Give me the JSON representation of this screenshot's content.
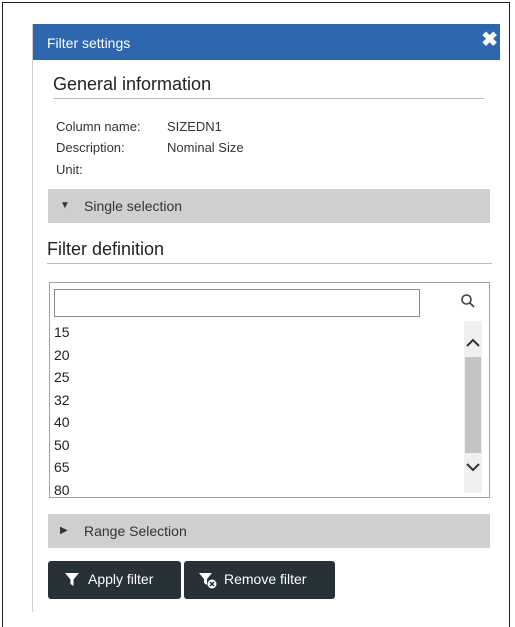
{
  "header": {
    "title": "Filter settings",
    "close_icon": "close-icon"
  },
  "general": {
    "title": "General information",
    "column_name_label": "Column name:",
    "column_name_value": "SIZEDN1",
    "description_label": "Description:",
    "description_value": "Nominal Size",
    "unit_label": "Unit:",
    "unit_value": ""
  },
  "single_selection": {
    "label": "Single selection",
    "state": "expanded"
  },
  "filter_definition": {
    "title": "Filter definition",
    "search_value": "",
    "search_icon": "search-icon",
    "items": [
      "15",
      "20",
      "25",
      "32",
      "40",
      "50",
      "65",
      "80"
    ]
  },
  "range_selection": {
    "label": "Range Selection",
    "state": "collapsed"
  },
  "buttons": {
    "apply_label": "Apply filter",
    "remove_label": "Remove filter"
  },
  "colors": {
    "titlebar": "#2e67ad",
    "accordion": "#cfcfcf",
    "button": "#263238"
  }
}
